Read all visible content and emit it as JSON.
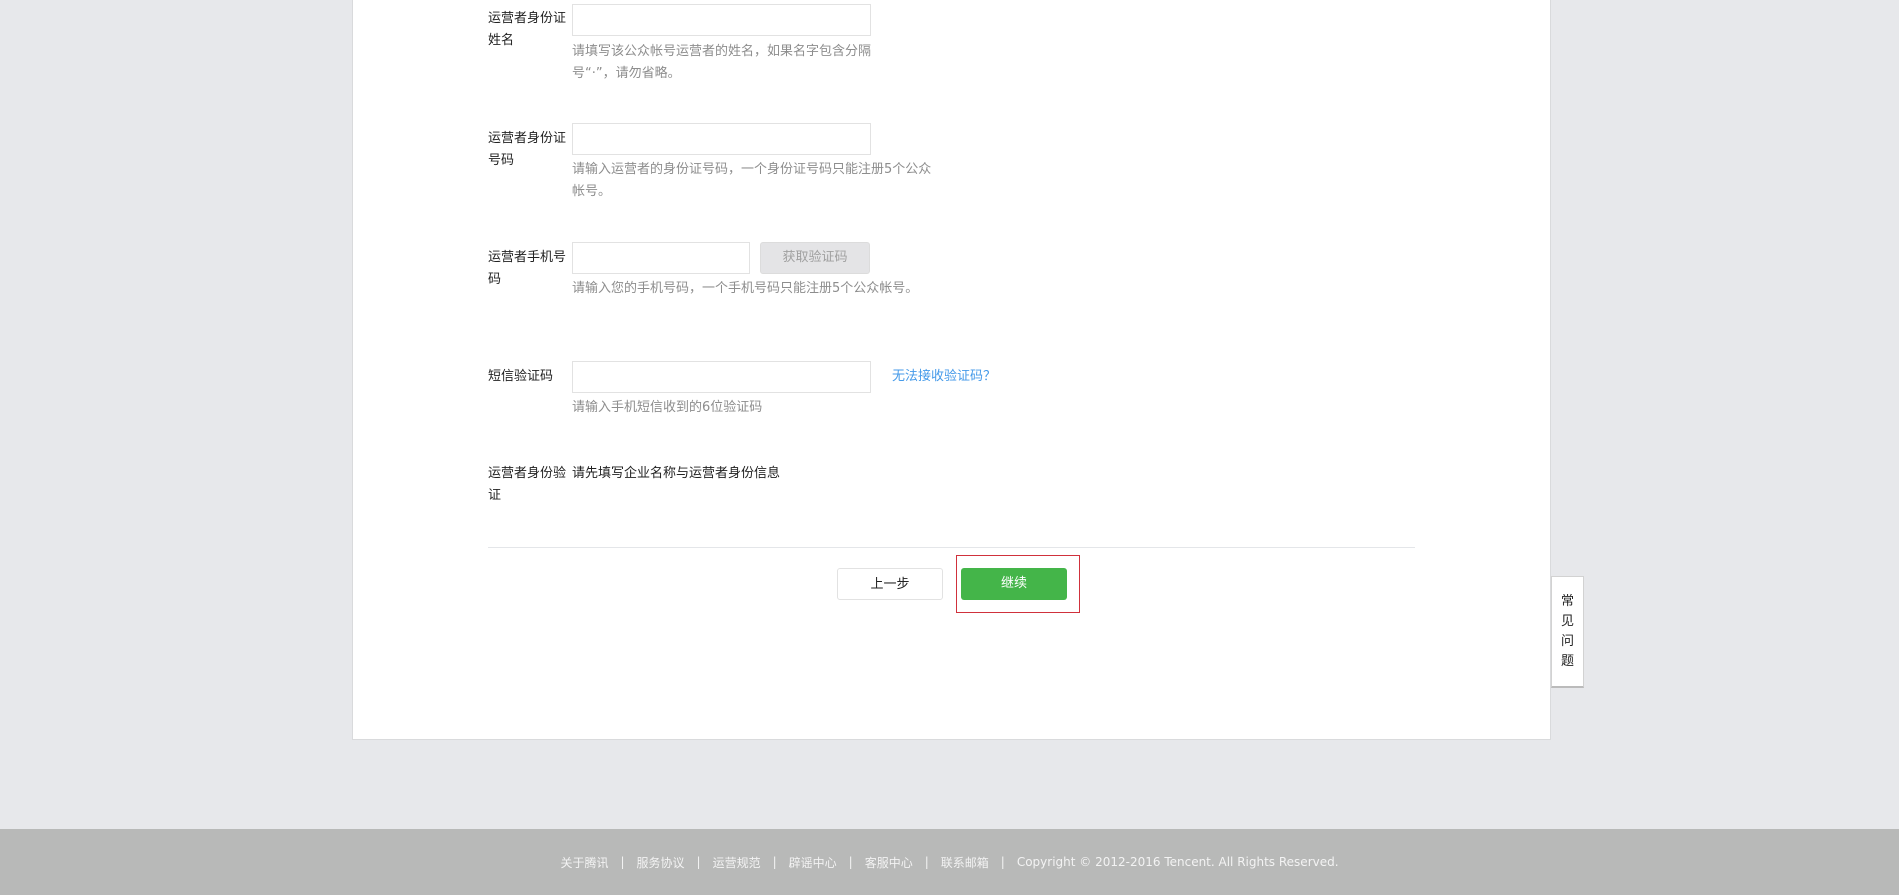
{
  "form": {
    "rows": [
      {
        "label": "运营者身份证姓名",
        "hint": "请填写该公众帐号运营者的姓名，如果名字包含分隔号“·”，请勿省略。"
      },
      {
        "label": "运营者身份证号码",
        "hint": "请输入运营者的身份证号码，一个身份证号码只能注册5个公众帐号。"
      },
      {
        "label": "运营者手机号码",
        "hint": "请输入您的手机号码，一个手机号码只能注册5个公众帐号。",
        "button": "获取验证码"
      },
      {
        "label": "短信验证码",
        "hint": "请输入手机短信收到的6位验证码",
        "link": "无法接收验证码？"
      },
      {
        "label": "运营者身份验证",
        "value": "请先填写企业名称与运营者身份信息"
      }
    ],
    "back_label": "上一步",
    "continue_label": "继续"
  },
  "faq": [
    "常",
    "见",
    "问",
    "题"
  ],
  "footer": {
    "links": [
      "关于腾讯",
      "服务协议",
      "运营规范",
      "辟谣中心",
      "客服中心",
      "联系邮箱"
    ],
    "copyright": "Copyright © 2012-2016 Tencent. All Rights Reserved."
  },
  "colors": {
    "accent": "#44b549",
    "link": "#459ae9",
    "highlight": "#d0313c"
  }
}
